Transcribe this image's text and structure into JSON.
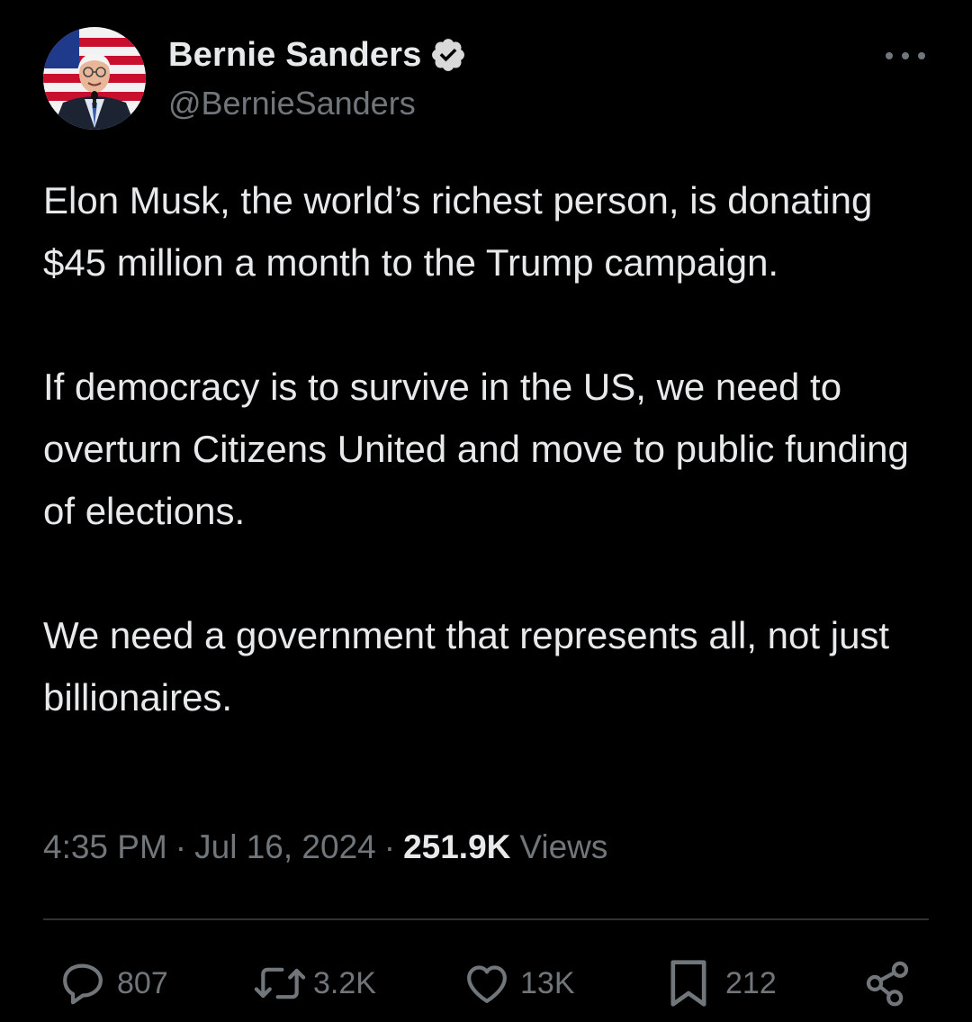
{
  "author": {
    "display_name": "Bernie Sanders",
    "handle": "@BernieSanders",
    "verified": true,
    "avatar": "portrait-with-american-flag-background"
  },
  "tweet": {
    "text": "Elon Musk, the world’s richest person, is donating  $45 million a month to the Trump campaign.\n\nIf democracy is to survive in the US, we need to overturn Citizens United and move to public funding of elections.\n\nWe need a government that represents all, not just billionaires.",
    "time": "4:35 PM",
    "date": "Jul 16, 2024",
    "separator": "·",
    "views_count": "251.9K",
    "views_label": "Views"
  },
  "actions": {
    "replies": "807",
    "reposts": "3.2K",
    "likes": "13K",
    "bookmarks": "212"
  },
  "icons": [
    "more-icon",
    "verified-badge-icon",
    "reply-icon",
    "repost-icon",
    "like-icon",
    "bookmark-icon",
    "share-icon"
  ],
  "colors": {
    "background": "#000000",
    "primary_text": "#e7e9ea",
    "secondary_text": "#71767b",
    "divider": "#2f3336",
    "verified_badge": "#d9d9d9"
  }
}
